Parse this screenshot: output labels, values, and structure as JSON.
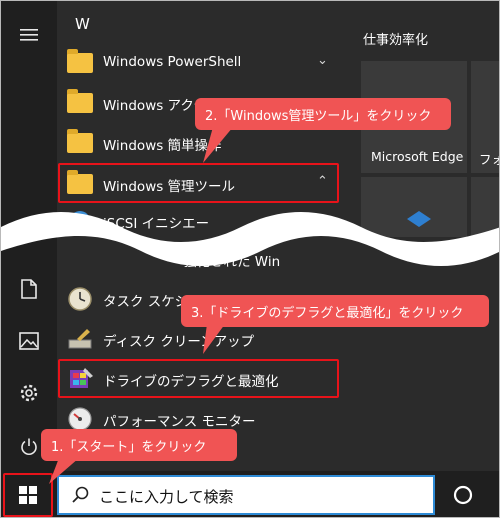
{
  "app_list": {
    "letter": "W",
    "items": [
      {
        "label": "Windows PowerShell",
        "chevron": "⌄"
      },
      {
        "label": "Windows アクセ"
      },
      {
        "label": "Windows 簡単操作"
      },
      {
        "label": "Windows 管理ツール",
        "chevron": "⌃"
      },
      {
        "label": "iSCSI イニシエー"
      },
      {
        "label": "強化された Win"
      },
      {
        "label": "タスク スケジュ"
      },
      {
        "label": "ディスク クリーンアップ"
      },
      {
        "label": "ドライブのデフラグと最適化"
      },
      {
        "label": "パフォーマンス モニター"
      }
    ]
  },
  "tiles": {
    "group_title": "仕事効率化",
    "edge_label": "Microsoft Edge",
    "partial_label": "フォ"
  },
  "search": {
    "placeholder": "ここに入力して検索"
  },
  "callouts": {
    "step1": "1.「スタート」をクリック",
    "step2": "2.「Windows管理ツール」をクリック",
    "step3": "3.「ドライブのデフラグと最適化」をクリック"
  },
  "icons": {
    "hamburger": "hamburger-icon",
    "document": "document-icon",
    "pictures": "pictures-icon",
    "settings": "gear-icon",
    "power": "power-icon",
    "windows": "windows-logo-icon",
    "search": "search-icon",
    "cortana": "cortana-circle-icon"
  },
  "colors": {
    "highlight": "#e8131a",
    "callout": "#f05454",
    "search_border": "#2e8bd6",
    "folder": "#f5c242"
  }
}
